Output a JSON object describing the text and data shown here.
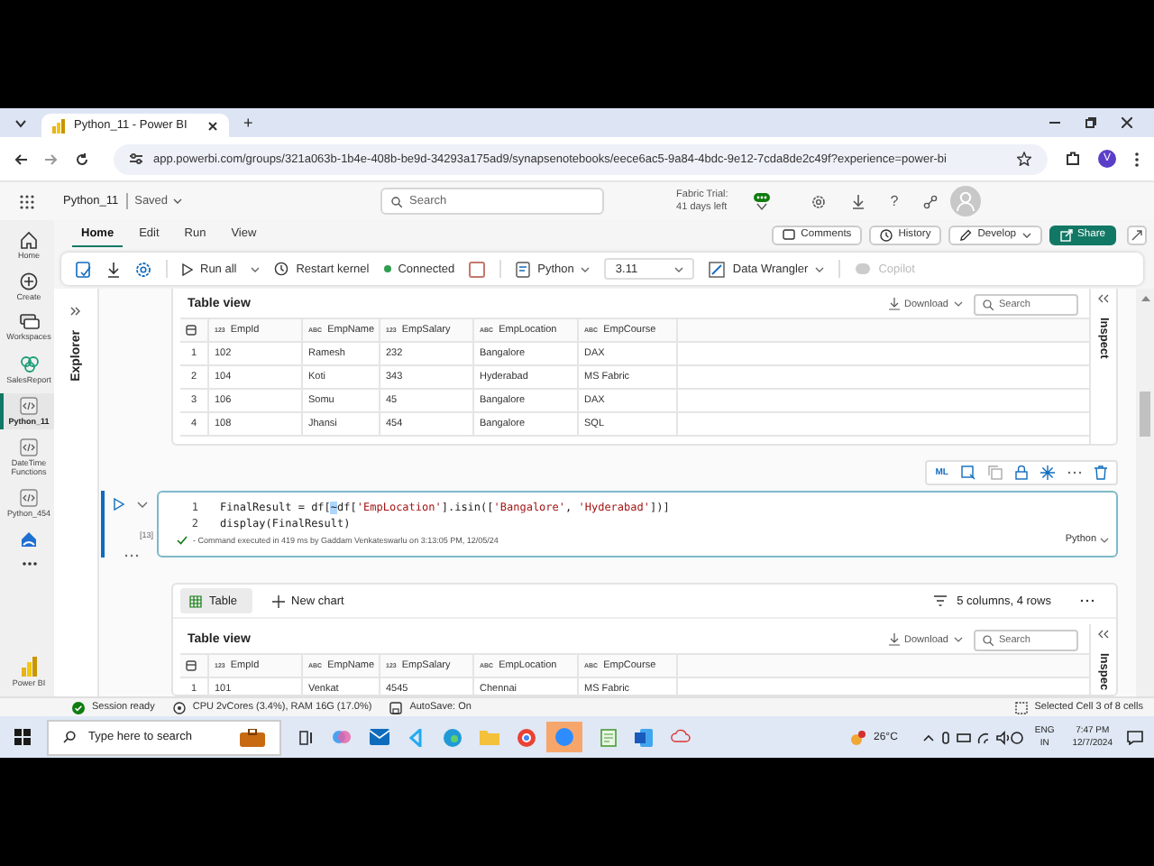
{
  "browser": {
    "tab_title": "Python_11 - Power BI",
    "new_tab": "+",
    "url": "app.powerbi.com/groups/321a063b-1b4e-408b-be9d-34293a175ad9/synapsenotebooks/eece6ac5-9a84-4bdc-9e12-7cda8de2c49f?experience=power-bi",
    "profile_initial": "V"
  },
  "header": {
    "notebook_name": "Python_11",
    "save_state": "Saved",
    "search_placeholder": "Search",
    "trial_line1": "Fabric Trial:",
    "trial_line2": "41 days left",
    "help": "?"
  },
  "nav": [
    {
      "label": "Home",
      "kind": "home",
      "selected": false
    },
    {
      "label": "Create",
      "kind": "create",
      "selected": false
    },
    {
      "label": "Workspaces",
      "kind": "workspaces",
      "selected": false
    },
    {
      "label": "SalesReport",
      "kind": "report",
      "selected": false
    },
    {
      "label": "Python_11",
      "kind": "notebook",
      "selected": true
    },
    {
      "label": "DateTime Functions",
      "kind": "notebook",
      "selected": false
    },
    {
      "label": "Python_454",
      "kind": "notebook",
      "selected": false
    },
    {
      "kind": "lakehouse",
      "selected": false
    },
    {
      "kind": "more",
      "selected": false
    }
  ],
  "nav_footer": "Power BI",
  "ribbon": {
    "tabs": [
      {
        "label": "Home",
        "selected": true
      },
      {
        "label": "Edit",
        "selected": false
      },
      {
        "label": "Run",
        "selected": false
      },
      {
        "label": "View",
        "selected": false
      }
    ],
    "actions": [
      {
        "label": "Comments",
        "kind": "comments"
      },
      {
        "label": "History",
        "kind": "history"
      },
      {
        "label": "Develop",
        "kind": "develop"
      },
      {
        "label": "Share",
        "kind": "share"
      }
    ]
  },
  "toolbar": {
    "run_all": "Run all",
    "restart": "Restart kernel",
    "status": "Connected",
    "connected": true,
    "language": "Python",
    "version": "3.11",
    "wrangler": "Data Wrangler",
    "copilot": "Copilot",
    "copilot_disabled": true
  },
  "explorer_label": "Explorer",
  "output_1": {
    "title": "Table view",
    "download": "Download",
    "search_placeholder": "Search",
    "inspect": "Inspect",
    "columns": [
      {
        "type": "123",
        "name": "EmpId"
      },
      {
        "type": "ABC",
        "name": "EmpName"
      },
      {
        "type": "123",
        "name": "EmpSalary"
      },
      {
        "type": "ABC",
        "name": "EmpLocation"
      },
      {
        "type": "ABC",
        "name": "EmpCourse"
      }
    ],
    "rows": [
      {
        "number": "1",
        "cells": [
          "102",
          "Ramesh",
          "232",
          "Bangalore",
          "DAX"
        ]
      },
      {
        "number": "2",
        "cells": [
          "104",
          "Koti",
          "343",
          "Hyderabad",
          "MS Fabric"
        ]
      },
      {
        "number": "3",
        "cells": [
          "106",
          "Somu",
          "45",
          "Bangalore",
          "DAX"
        ]
      },
      {
        "number": "4",
        "cells": [
          "108",
          "Jhansi",
          "454",
          "Bangalore",
          "SQL"
        ]
      }
    ]
  },
  "cell": {
    "ml": "ML",
    "execution_count": "[13]",
    "status": "- Command executed in 419 ms by Gaddam Venkateswarlu on 3:13:05 PM, 12/05/24",
    "language": "Python",
    "lines": [
      {
        "number": "1",
        "tokens": [
          {
            "kind": "code",
            "text": "FinalResult = df["
          },
          {
            "kind": "selection",
            "text": "~"
          },
          {
            "kind": "code",
            "text": "df["
          },
          {
            "kind": "string",
            "text": "'EmpLocation'"
          },
          {
            "kind": "code",
            "text": "].isin(["
          },
          {
            "kind": "string",
            "text": "'Bangalore'"
          },
          {
            "kind": "code",
            "text": ", "
          },
          {
            "kind": "string",
            "text": "'Hyderabad'"
          },
          {
            "kind": "code",
            "text": "])]"
          }
        ]
      },
      {
        "number": "2",
        "tokens": [
          {
            "kind": "code",
            "text": "display(FinalResult)"
          }
        ]
      }
    ]
  },
  "output_2": {
    "tabs": [
      {
        "label": "Table",
        "selected": true
      },
      {
        "label": "New chart",
        "selected": false
      }
    ],
    "summary": "5 columns, 4 rows",
    "title": "Table view",
    "download": "Download",
    "search_placeholder": "Search",
    "inspect": "Inspec",
    "columns": [
      {
        "type": "123",
        "name": "EmpId"
      },
      {
        "type": "ABC",
        "name": "EmpName"
      },
      {
        "type": "123",
        "name": "EmpSalary"
      },
      {
        "type": "ABC",
        "name": "EmpLocation"
      },
      {
        "type": "ABC",
        "name": "EmpCourse"
      }
    ],
    "rows": [
      {
        "number": "1",
        "cells": [
          "101",
          "Venkat",
          "4545",
          "Chennai",
          "MS Fabric"
        ]
      }
    ]
  },
  "status_bar": {
    "session": "Session ready",
    "cpu": "CPU 2vCores (3.4%), RAM 16G (17.0%)",
    "autosave": "AutoSave: On",
    "selection": "Selected Cell 3 of 8 cells"
  },
  "taskbar": {
    "search_placeholder": "Type here to search",
    "weather": "26°C",
    "lang1": "ENG",
    "lang2": "IN",
    "time": "7:47 PM",
    "date": "12/7/2024"
  }
}
